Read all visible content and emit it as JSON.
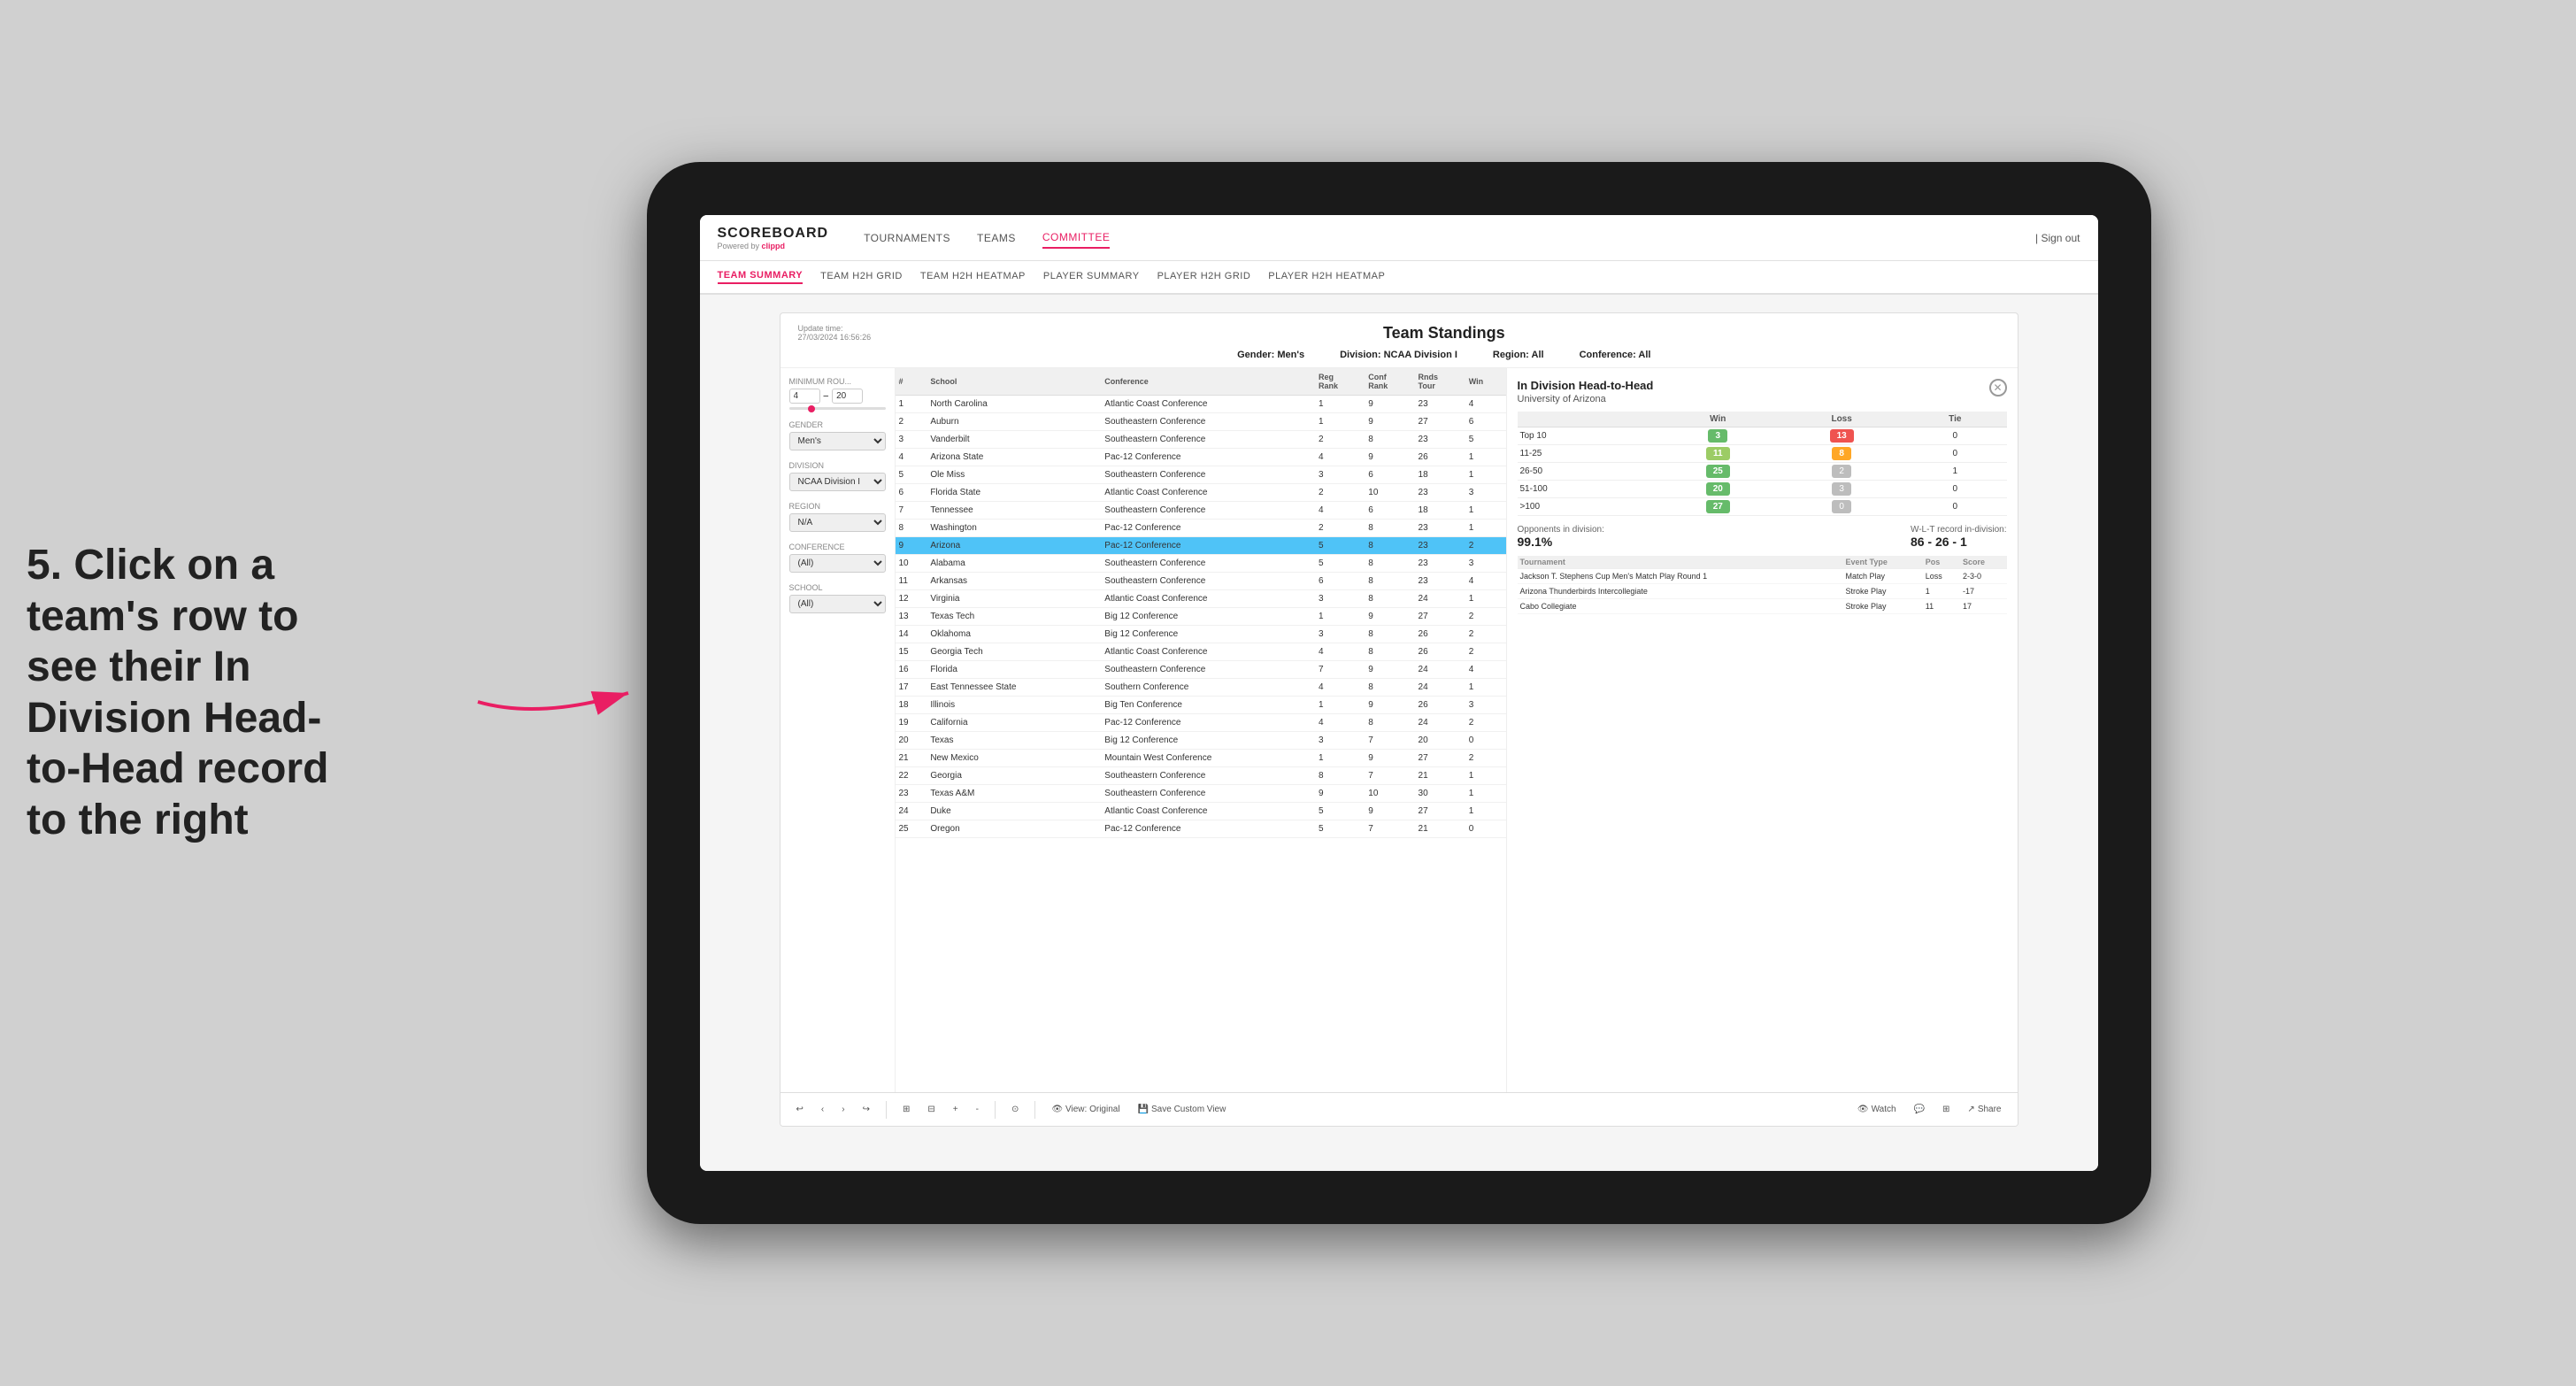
{
  "outer": {
    "background": "#d0d0d0"
  },
  "annotation": {
    "text": "5. Click on a team's row to see their In Division Head-to-Head record to the right"
  },
  "nav": {
    "logo": "SCOREBOARD",
    "logo_sub": "Powered by clippd",
    "items": [
      "TOURNAMENTS",
      "TEAMS",
      "COMMITTEE"
    ],
    "active_nav": "COMMITTEE",
    "sign_out": "Sign out"
  },
  "sub_nav": {
    "items": [
      "TEAM SUMMARY",
      "TEAM H2H GRID",
      "TEAM H2H HEATMAP",
      "PLAYER SUMMARY",
      "PLAYER H2H GRID",
      "PLAYER H2H HEATMAP"
    ],
    "active": "TEAM SUMMARY"
  },
  "card": {
    "update_time": "Update time:",
    "update_date": "27/03/2024 16:56:26",
    "title": "Team Standings",
    "gender_label": "Gender:",
    "gender_value": "Men's",
    "division_label": "Division:",
    "division_value": "NCAA Division I",
    "region_label": "Region:",
    "region_value": "All",
    "conference_label": "Conference:",
    "conference_value": "All"
  },
  "filters": {
    "min_rounds_label": "Minimum Rou...",
    "min_rounds_value": "4",
    "max_rounds_value": "20",
    "gender_label": "Gender",
    "gender_value": "Men's",
    "division_label": "Division",
    "division_value": "NCAA Division I",
    "region_label": "Region",
    "region_value": "N/A",
    "conference_label": "Conference",
    "conference_value": "(All)",
    "school_label": "School",
    "school_value": "(All)"
  },
  "table": {
    "headers": [
      "#",
      "School",
      "Conference",
      "Reg Rank",
      "Conf Rank",
      "Rnd Tour",
      "Win"
    ],
    "rows": [
      {
        "rank": 1,
        "school": "North Carolina",
        "conference": "Atlantic Coast Conference",
        "reg": 1,
        "conf": 9,
        "rnds": 23,
        "wins": 4,
        "selected": false
      },
      {
        "rank": 2,
        "school": "Auburn",
        "conference": "Southeastern Conference",
        "reg": 1,
        "conf": 9,
        "rnds": 27,
        "wins": 6,
        "selected": false
      },
      {
        "rank": 3,
        "school": "Vanderbilt",
        "conference": "Southeastern Conference",
        "reg": 2,
        "conf": 8,
        "rnds": 23,
        "wins": 5,
        "selected": false
      },
      {
        "rank": 4,
        "school": "Arizona State",
        "conference": "Pac-12 Conference",
        "reg": 4,
        "conf": 9,
        "rnds": 26,
        "wins": 1,
        "selected": false
      },
      {
        "rank": 5,
        "school": "Ole Miss",
        "conference": "Southeastern Conference",
        "reg": 3,
        "conf": 6,
        "rnds": 18,
        "wins": 1,
        "selected": false
      },
      {
        "rank": 6,
        "school": "Florida State",
        "conference": "Atlantic Coast Conference",
        "reg": 2,
        "conf": 10,
        "rnds": 23,
        "wins": 3,
        "selected": false
      },
      {
        "rank": 7,
        "school": "Tennessee",
        "conference": "Southeastern Conference",
        "reg": 4,
        "conf": 6,
        "rnds": 18,
        "wins": 1,
        "selected": false
      },
      {
        "rank": 8,
        "school": "Washington",
        "conference": "Pac-12 Conference",
        "reg": 2,
        "conf": 8,
        "rnds": 23,
        "wins": 1,
        "selected": false
      },
      {
        "rank": 9,
        "school": "Arizona",
        "conference": "Pac-12 Conference",
        "reg": 5,
        "conf": 8,
        "rnds": 23,
        "wins": 2,
        "selected": true
      },
      {
        "rank": 10,
        "school": "Alabama",
        "conference": "Southeastern Conference",
        "reg": 5,
        "conf": 8,
        "rnds": 23,
        "wins": 3,
        "selected": false
      },
      {
        "rank": 11,
        "school": "Arkansas",
        "conference": "Southeastern Conference",
        "reg": 6,
        "conf": 8,
        "rnds": 23,
        "wins": 4,
        "selected": false
      },
      {
        "rank": 12,
        "school": "Virginia",
        "conference": "Atlantic Coast Conference",
        "reg": 3,
        "conf": 8,
        "rnds": 24,
        "wins": 1,
        "selected": false
      },
      {
        "rank": 13,
        "school": "Texas Tech",
        "conference": "Big 12 Conference",
        "reg": 1,
        "conf": 9,
        "rnds": 27,
        "wins": 2,
        "selected": false
      },
      {
        "rank": 14,
        "school": "Oklahoma",
        "conference": "Big 12 Conference",
        "reg": 3,
        "conf": 8,
        "rnds": 26,
        "wins": 2,
        "selected": false
      },
      {
        "rank": 15,
        "school": "Georgia Tech",
        "conference": "Atlantic Coast Conference",
        "reg": 4,
        "conf": 8,
        "rnds": 26,
        "wins": 2,
        "selected": false
      },
      {
        "rank": 16,
        "school": "Florida",
        "conference": "Southeastern Conference",
        "reg": 7,
        "conf": 9,
        "rnds": 24,
        "wins": 4,
        "selected": false
      },
      {
        "rank": 17,
        "school": "East Tennessee State",
        "conference": "Southern Conference",
        "reg": 4,
        "conf": 8,
        "rnds": 24,
        "wins": 1,
        "selected": false
      },
      {
        "rank": 18,
        "school": "Illinois",
        "conference": "Big Ten Conference",
        "reg": 1,
        "conf": 9,
        "rnds": 26,
        "wins": 3,
        "selected": false
      },
      {
        "rank": 19,
        "school": "California",
        "conference": "Pac-12 Conference",
        "reg": 4,
        "conf": 8,
        "rnds": 24,
        "wins": 2,
        "selected": false
      },
      {
        "rank": 20,
        "school": "Texas",
        "conference": "Big 12 Conference",
        "reg": 3,
        "conf": 7,
        "rnds": 20,
        "wins": 0,
        "selected": false
      },
      {
        "rank": 21,
        "school": "New Mexico",
        "conference": "Mountain West Conference",
        "reg": 1,
        "conf": 9,
        "rnds": 27,
        "wins": 2,
        "selected": false
      },
      {
        "rank": 22,
        "school": "Georgia",
        "conference": "Southeastern Conference",
        "reg": 8,
        "conf": 7,
        "rnds": 21,
        "wins": 1,
        "selected": false
      },
      {
        "rank": 23,
        "school": "Texas A&M",
        "conference": "Southeastern Conference",
        "reg": 9,
        "conf": 10,
        "rnds": 30,
        "wins": 1,
        "selected": false
      },
      {
        "rank": 24,
        "school": "Duke",
        "conference": "Atlantic Coast Conference",
        "reg": 5,
        "conf": 9,
        "rnds": 27,
        "wins": 1,
        "selected": false
      },
      {
        "rank": 25,
        "school": "Oregon",
        "conference": "Pac-12 Conference",
        "reg": 5,
        "conf": 7,
        "rnds": 21,
        "wins": 0,
        "selected": false
      }
    ]
  },
  "h2h": {
    "title": "In Division Head-to-Head",
    "school": "University of Arizona",
    "win_label": "Win",
    "loss_label": "Loss",
    "tie_label": "Tie",
    "rows": [
      {
        "range": "Top 10",
        "win": 3,
        "loss": 13,
        "tie": 0,
        "win_color": "green",
        "loss_color": "red"
      },
      {
        "range": "11-25",
        "win": 11,
        "loss": 8,
        "tie": 0,
        "win_color": "yellow-green",
        "loss_color": "orange"
      },
      {
        "range": "26-50",
        "win": 25,
        "loss": 2,
        "tie": 1,
        "win_color": "green",
        "loss_color": "gray"
      },
      {
        "range": "51-100",
        "win": 20,
        "loss": 3,
        "tie": 0,
        "win_color": "green",
        "loss_color": "gray"
      },
      {
        "range": ">100",
        "win": 27,
        "loss": 0,
        "tie": 0,
        "win_color": "green",
        "loss_color": "gray"
      }
    ],
    "opponents_label": "Opponents in division:",
    "opponents_value": "99.1%",
    "wlt_label": "W-L-T record in-division:",
    "wlt_value": "86 - 26 - 1",
    "tournament_headers": [
      "Tournament",
      "Event Type",
      "Pos",
      "Score"
    ],
    "tournaments": [
      {
        "name": "Jackson T. Stephens Cup Men's Match Play Round 1",
        "type": "Match Play",
        "pos": "Loss",
        "score": "2-3-0"
      },
      {
        "name": "Arizona Thunderbirds Intercollegiate",
        "type": "Stroke Play",
        "pos": "1",
        "score": "-17"
      },
      {
        "name": "Cabo Collegiate",
        "type": "Stroke Play",
        "pos": "11",
        "score": "17"
      }
    ]
  },
  "toolbar": {
    "undo": "↩",
    "redo": "↪",
    "view_original": "View: Original",
    "save_custom": "Save Custom View",
    "watch": "Watch",
    "share": "Share"
  }
}
